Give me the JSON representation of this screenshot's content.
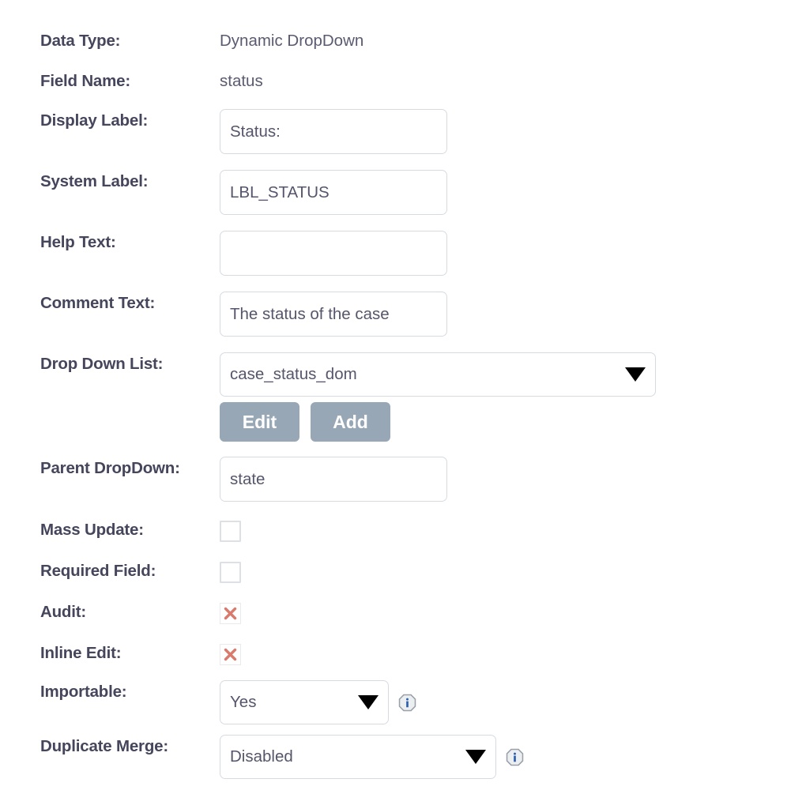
{
  "form": {
    "rows": [
      {
        "label": "Data Type:",
        "value": "Dynamic DropDown",
        "type": "static"
      },
      {
        "label": "Field Name:",
        "value": "status",
        "type": "static"
      },
      {
        "label": "Display Label:",
        "value": "Status:",
        "type": "text"
      },
      {
        "label": "System Label:",
        "value": "LBL_STATUS",
        "type": "text"
      },
      {
        "label": "Help Text:",
        "value": "",
        "type": "text"
      },
      {
        "label": "Comment Text:",
        "value": "The status of the case",
        "type": "text"
      },
      {
        "label": "Drop Down List:",
        "value": "case_status_dom",
        "type": "select"
      },
      {
        "label": "Parent DropDown:",
        "value": "state",
        "type": "text"
      },
      {
        "label": "Mass Update:",
        "value": "unchecked",
        "type": "checkbox"
      },
      {
        "label": "Required Field:",
        "value": "unchecked",
        "type": "checkbox"
      },
      {
        "label": "Audit:",
        "value": "x-mark",
        "type": "xmark"
      },
      {
        "label": "Inline Edit:",
        "value": "x-mark",
        "type": "xmark"
      },
      {
        "label": "Importable:",
        "value": "Yes",
        "type": "select"
      },
      {
        "label": "Duplicate Merge:",
        "value": "Disabled",
        "type": "select"
      }
    ],
    "buttons": {
      "edit_label": "Edit",
      "add_label": "Add"
    },
    "icons": {
      "caret": "chevron-down-icon",
      "info": "info-icon",
      "xmark": "x-mark-icon"
    },
    "colors": {
      "label_text": "#45455c",
      "value_text": "#55556b",
      "border": "#d7dbe0",
      "button_bg": "#97a7b6",
      "xmark": "#d97a6c",
      "info_blue": "#2b5fb0",
      "background": "#ffffff"
    }
  }
}
